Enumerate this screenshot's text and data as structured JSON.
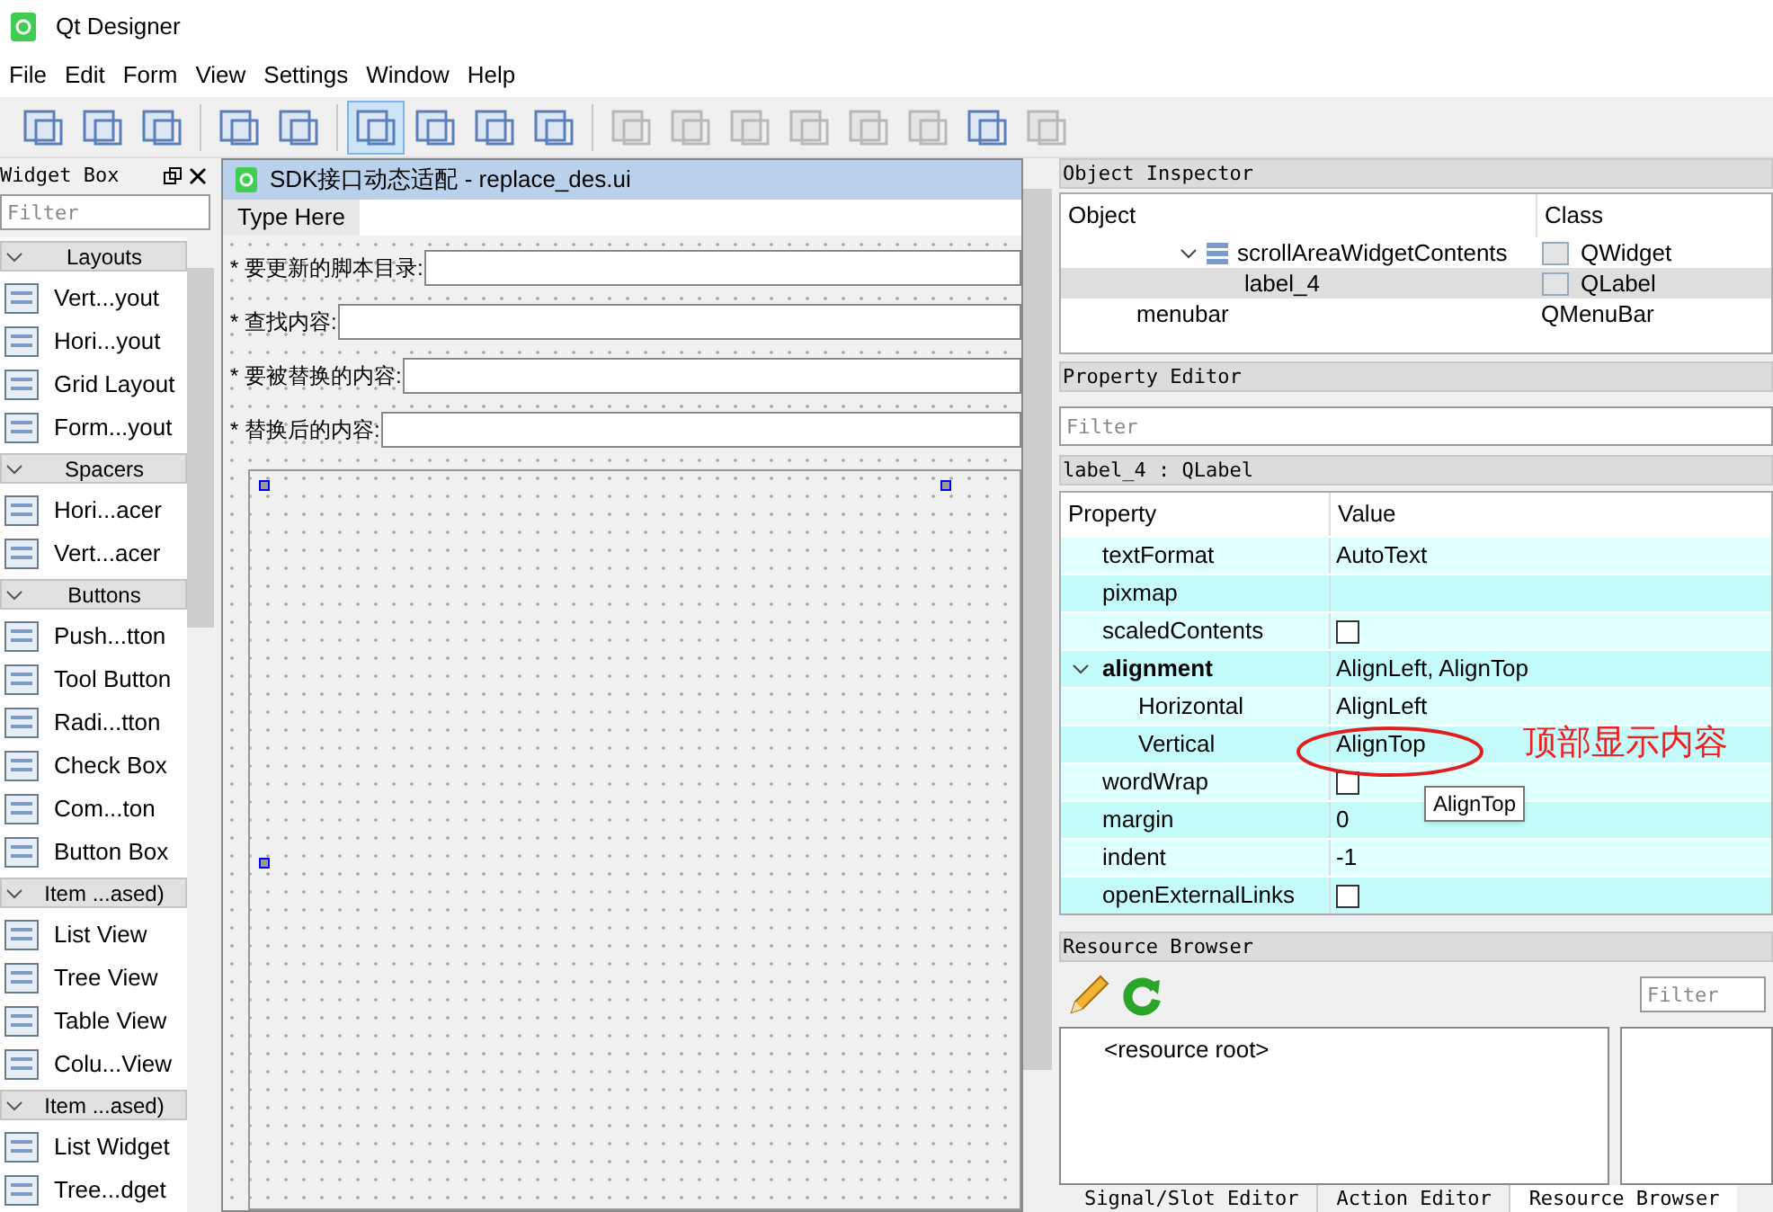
{
  "window": {
    "title": "Qt Designer"
  },
  "menu": [
    "File",
    "Edit",
    "Form",
    "View",
    "Settings",
    "Window",
    "Help"
  ],
  "toolbar": [
    {
      "selected": false,
      "disabled": false
    },
    {
      "selected": false,
      "disabled": false
    },
    {
      "selected": false,
      "disabled": false
    },
    {
      "selected": false,
      "disabled": false
    },
    {
      "selected": false,
      "disabled": false
    },
    {
      "selected": true,
      "disabled": false
    },
    {
      "selected": false,
      "disabled": false
    },
    {
      "selected": false,
      "disabled": false
    },
    {
      "selected": false,
      "disabled": false
    },
    {
      "selected": false,
      "disabled": true
    },
    {
      "selected": false,
      "disabled": true
    },
    {
      "selected": false,
      "disabled": true
    },
    {
      "selected": false,
      "disabled": true
    },
    {
      "selected": false,
      "disabled": true
    },
    {
      "selected": false,
      "disabled": true
    },
    {
      "selected": false,
      "disabled": false
    },
    {
      "selected": false,
      "disabled": true
    }
  ],
  "widget_box": {
    "title": "Widget Box",
    "filter_placeholder": "Filter",
    "items": [
      {
        "kind": "category",
        "label": "Layouts"
      },
      {
        "kind": "widget",
        "label": "Vert...yout"
      },
      {
        "kind": "widget",
        "label": "Hori...yout"
      },
      {
        "kind": "widget",
        "label": "Grid Layout"
      },
      {
        "kind": "widget",
        "label": "Form...yout"
      },
      {
        "kind": "category",
        "label": "Spacers"
      },
      {
        "kind": "widget",
        "label": "Hori...acer"
      },
      {
        "kind": "widget",
        "label": "Vert...acer"
      },
      {
        "kind": "category",
        "label": "Buttons"
      },
      {
        "kind": "widget",
        "label": "Push...tton"
      },
      {
        "kind": "widget",
        "label": "Tool Button"
      },
      {
        "kind": "widget",
        "label": "Radi...tton"
      },
      {
        "kind": "widget",
        "label": "Check Box"
      },
      {
        "kind": "widget",
        "label": "Com...ton"
      },
      {
        "kind": "widget",
        "label": "Button Box"
      },
      {
        "kind": "category",
        "label": "Item ...ased)"
      },
      {
        "kind": "widget",
        "label": "List View"
      },
      {
        "kind": "widget",
        "label": "Tree View"
      },
      {
        "kind": "widget",
        "label": "Table View"
      },
      {
        "kind": "widget",
        "label": "Colu...View"
      },
      {
        "kind": "category",
        "label": "Item ...ased)"
      },
      {
        "kind": "widget",
        "label": "List Widget"
      },
      {
        "kind": "widget",
        "label": "Tree...dget"
      }
    ]
  },
  "form": {
    "title": "SDK接口动态适配 - replace_des.ui",
    "menubar_hint": "Type Here",
    "rows": [
      {
        "label": "* 要更新的脚本目录:"
      },
      {
        "label": "* 查找内容:"
      },
      {
        "label": "* 要被替换的内容:"
      },
      {
        "label": "* 替换后的内容:"
      }
    ]
  },
  "object_inspector": {
    "title": "Object Inspector",
    "columns": [
      "Object",
      "Class"
    ],
    "rows": [
      {
        "object": "scrollAreaWidgetContents",
        "class": "QWidget",
        "expanded": true,
        "selected": false,
        "children": [
          {
            "object": "label_4",
            "class": "QLabel",
            "selected": true
          }
        ]
      },
      {
        "object": "menubar",
        "class": "QMenuBar",
        "selected": false
      }
    ]
  },
  "property_editor": {
    "title": "Property Editor",
    "filter_placeholder": "Filter",
    "object_label": "label_4 : QLabel",
    "columns": [
      "Property",
      "Value"
    ],
    "rows": [
      {
        "kind": "text",
        "name": "textFormat",
        "value": "AutoText"
      },
      {
        "kind": "text",
        "name": "pixmap"
      },
      {
        "kind": "checkbox",
        "name": "scaledContents",
        "checked": false
      },
      {
        "kind": "group",
        "name": "alignment",
        "value": "AlignLeft, AlignTop",
        "expanded": true
      },
      {
        "kind": "sub",
        "name": "Horizontal",
        "value": "AlignLeft"
      },
      {
        "kind": "sub",
        "name": "Vertical",
        "value": "AlignTop"
      },
      {
        "kind": "checkbox",
        "name": "wordWrap",
        "checked": false
      },
      {
        "kind": "text",
        "name": "margin",
        "value": "0"
      },
      {
        "kind": "text",
        "name": "indent",
        "value": "-1"
      },
      {
        "kind": "checkbox",
        "name": "openExternalLinks",
        "checked": false
      }
    ],
    "tooltip": "AlignTop",
    "annotation": "顶部显示内容"
  },
  "resource_browser": {
    "title": "Resource Browser",
    "filter_placeholder": "Filter",
    "root": "<resource root>"
  },
  "bottom_tabs": [
    {
      "label": "Signal/Slot Editor",
      "selected": false
    },
    {
      "label": "Action Editor",
      "selected": false
    },
    {
      "label": "Resource Browser",
      "selected": true
    }
  ]
}
